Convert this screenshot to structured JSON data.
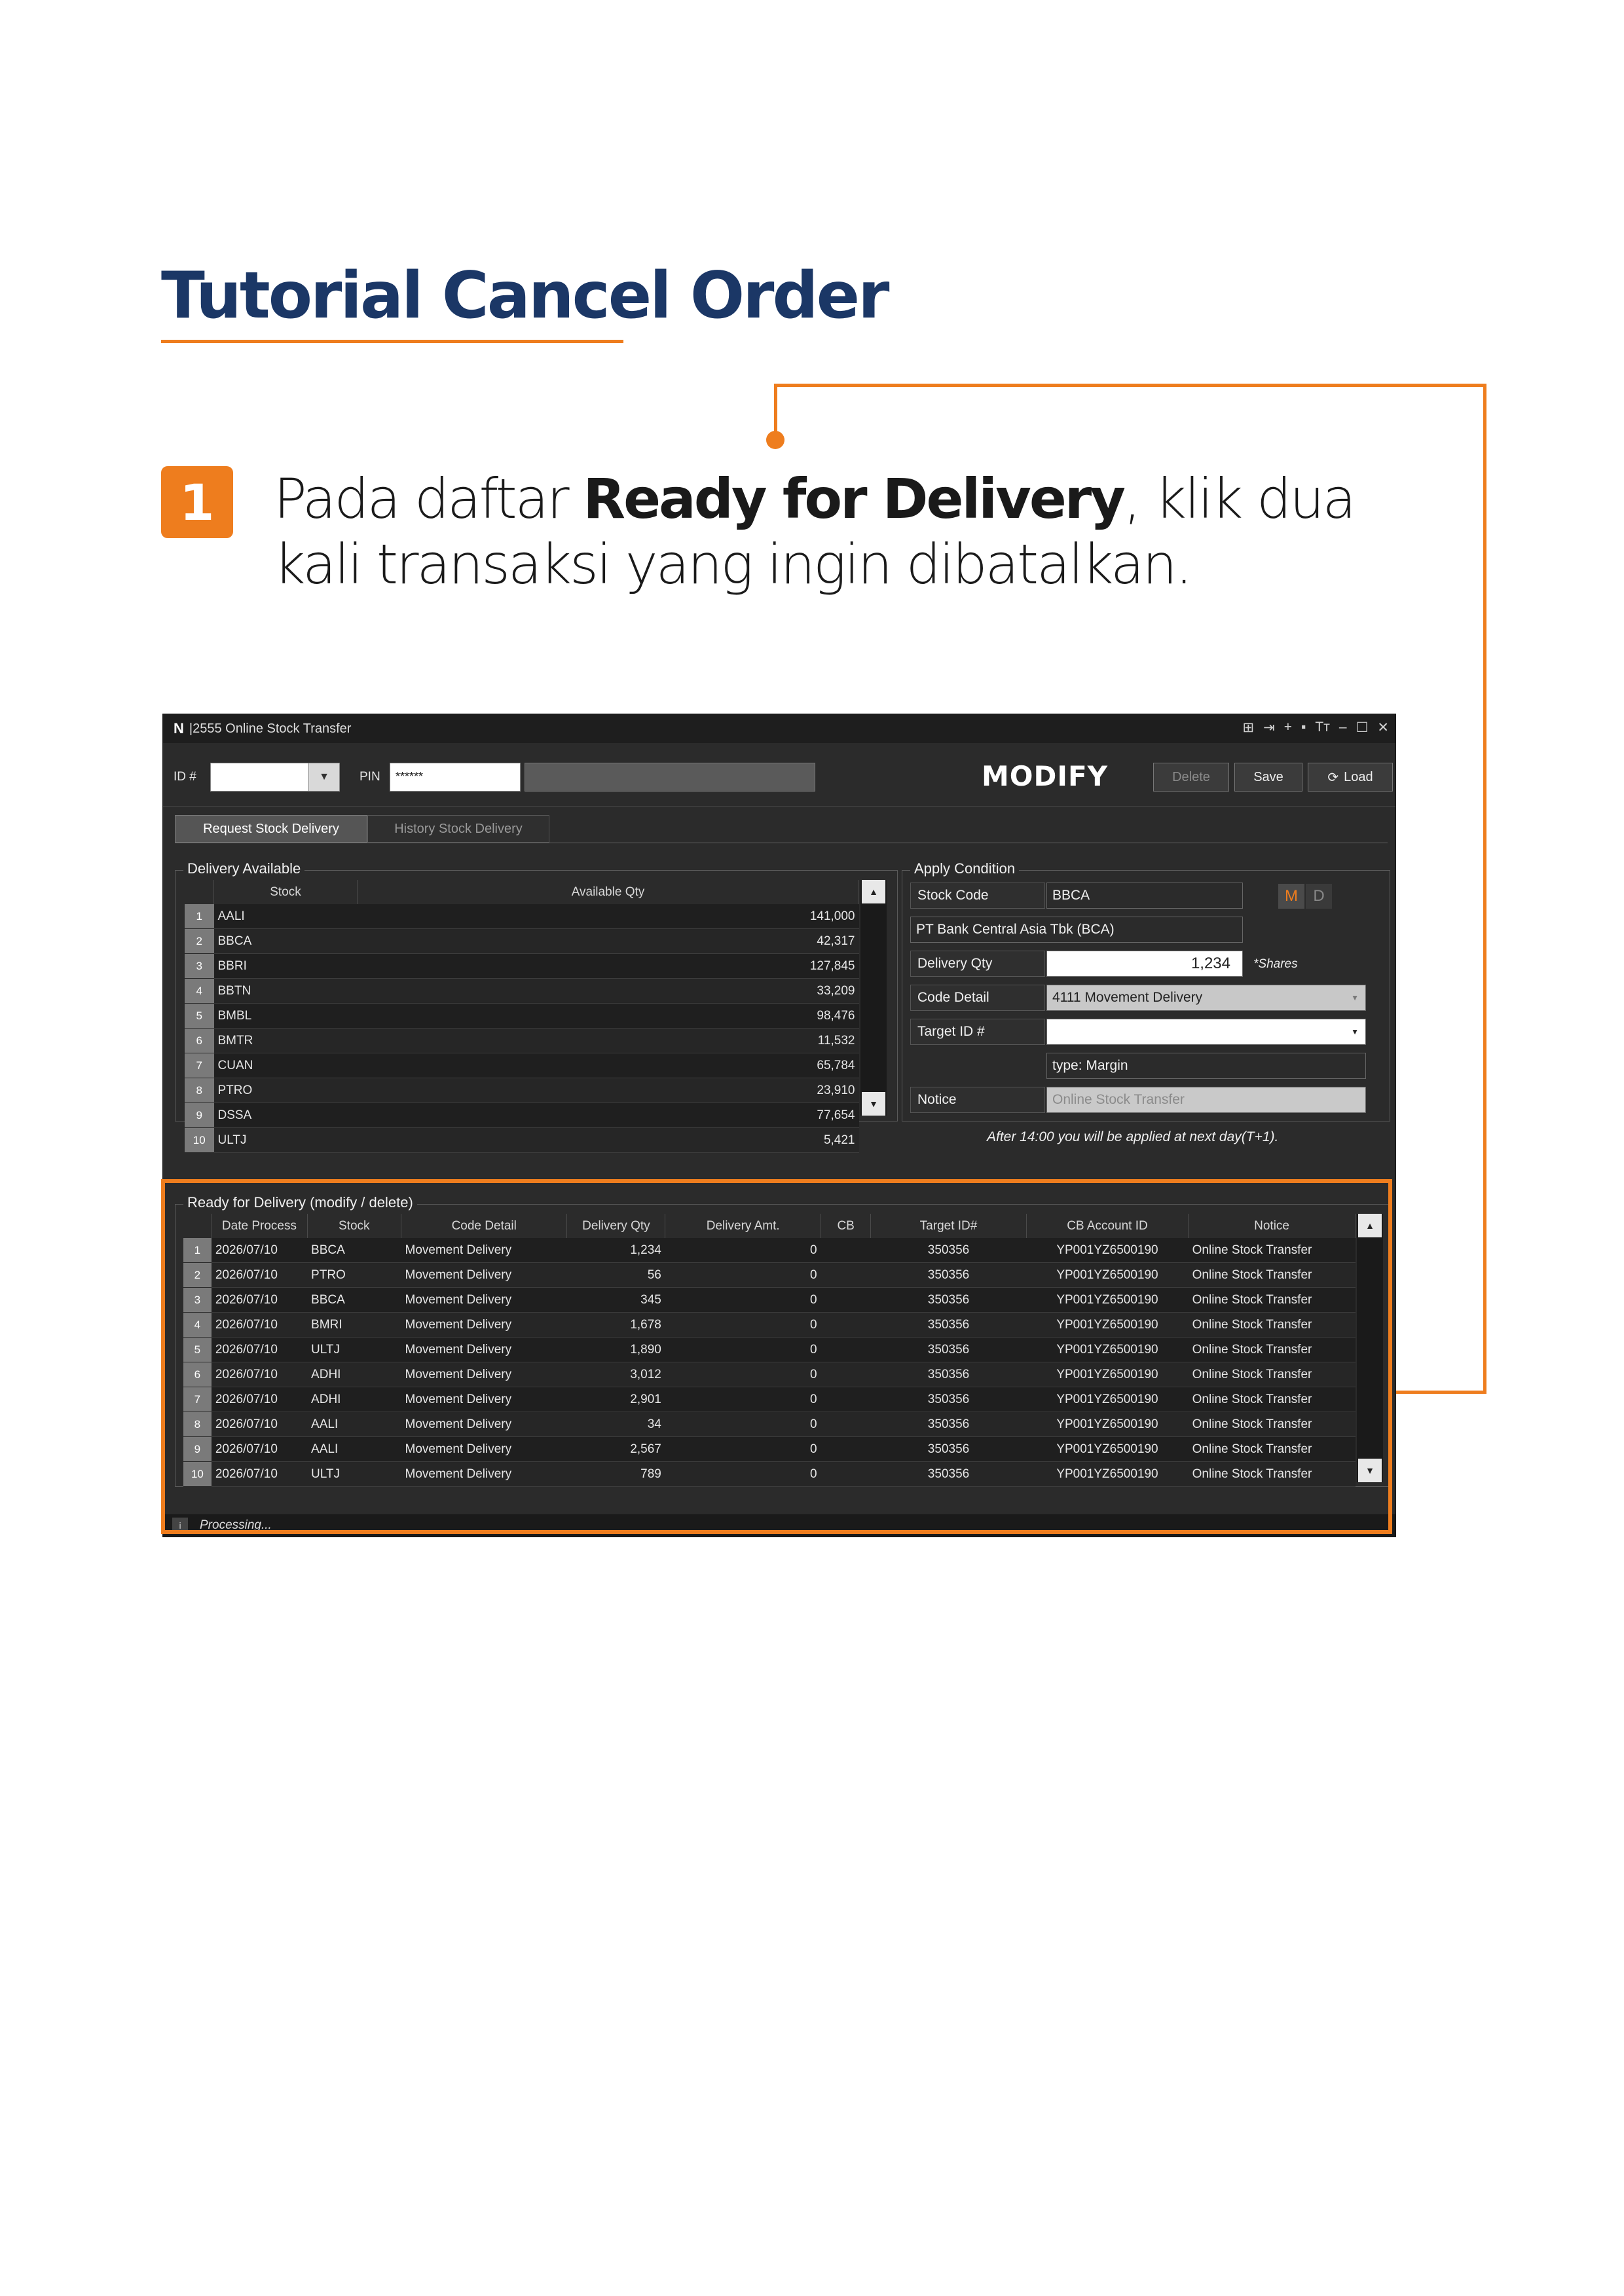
{
  "tutorial": {
    "title": "Tutorial Cancel Order",
    "step_number": "1",
    "step_text_before": "Pada daftar ",
    "step_text_bold": "Ready for Delivery",
    "step_text_after": ", klik dua kali transaksi yang ingin dibatalkan."
  },
  "colors": {
    "accent": "#ee7d1e",
    "title": "#1b3766",
    "window_bg": "#2b2b2b"
  },
  "window": {
    "logo": "N",
    "title": "|2555 Online Stock Transfer",
    "icons": [
      "grid-icon",
      "export-icon",
      "add-icon",
      "trash-icon",
      "font-size-icon",
      "minimize-icon",
      "maximize-icon",
      "close-icon"
    ]
  },
  "toolbar": {
    "id_label": "ID #",
    "id_value": "",
    "pin_label": "PIN",
    "pin_value": "******",
    "mode": "MODIFY",
    "delete_label": "Delete",
    "save_label": "Save",
    "load_label": "Load"
  },
  "tabs": [
    "Request Stock Delivery",
    "History Stock Delivery"
  ],
  "delivery_available": {
    "title": "Delivery Available",
    "columns": [
      "Stock",
      "Available Qty"
    ],
    "rows": [
      [
        "1",
        "AALI",
        "141,000"
      ],
      [
        "2",
        "BBCA",
        "42,317"
      ],
      [
        "3",
        "BBRI",
        "127,845"
      ],
      [
        "4",
        "BBTN",
        "33,209"
      ],
      [
        "5",
        "BMBL",
        "98,476"
      ],
      [
        "6",
        "BMTR",
        "11,532"
      ],
      [
        "7",
        "CUAN",
        "65,784"
      ],
      [
        "8",
        "PTRO",
        "23,910"
      ],
      [
        "9",
        "DSSA",
        "77,654"
      ],
      [
        "10",
        "ULTJ",
        "5,421"
      ]
    ]
  },
  "apply_condition": {
    "title": "Apply Condition",
    "stock_code_label": "Stock Code",
    "stock_code_value": "BBCA",
    "mode_m": "M",
    "mode_d": "D",
    "company_name": "PT Bank Central Asia Tbk (BCA)",
    "delivery_qty_label": "Delivery Qty",
    "delivery_qty_value": "1,234",
    "shares_note": "*Shares",
    "code_detail_label": "Code Detail",
    "code_detail_value": "4111 Movement Delivery",
    "target_id_label": "Target ID #",
    "target_id_value": "",
    "account_type": "type: Margin",
    "notice_label": "Notice",
    "notice_placeholder": "Online Stock Transfer",
    "footnote": "After 14:00 you will be applied at next day(T+1)."
  },
  "ready_for_delivery": {
    "title": "Ready for Delivery (modify / delete)",
    "columns": [
      "Date Process",
      "Stock",
      "Code Detail",
      "Delivery Qty",
      "Delivery Amt.",
      "CB",
      "Target ID#",
      "CB Account ID",
      "Notice"
    ],
    "rows": [
      [
        "1",
        "2026/07/10",
        "BBCA",
        "Movement Delivery",
        "1,234",
        "0",
        "",
        "350356",
        "YP001YZ6500190",
        "Online Stock Transfer"
      ],
      [
        "2",
        "2026/07/10",
        "PTRO",
        "Movement Delivery",
        "56",
        "0",
        "",
        "350356",
        "YP001YZ6500190",
        "Online Stock Transfer"
      ],
      [
        "3",
        "2026/07/10",
        "BBCA",
        "Movement Delivery",
        "345",
        "0",
        "",
        "350356",
        "YP001YZ6500190",
        "Online Stock Transfer"
      ],
      [
        "4",
        "2026/07/10",
        "BMRI",
        "Movement Delivery",
        "1,678",
        "0",
        "",
        "350356",
        "YP001YZ6500190",
        "Online Stock Transfer"
      ],
      [
        "5",
        "2026/07/10",
        "ULTJ",
        "Movement Delivery",
        "1,890",
        "0",
        "",
        "350356",
        "YP001YZ6500190",
        "Online Stock Transfer"
      ],
      [
        "6",
        "2026/07/10",
        "ADHI",
        "Movement Delivery",
        "3,012",
        "0",
        "",
        "350356",
        "YP001YZ6500190",
        "Online Stock Transfer"
      ],
      [
        "7",
        "2026/07/10",
        "ADHI",
        "Movement Delivery",
        "2,901",
        "0",
        "",
        "350356",
        "YP001YZ6500190",
        "Online Stock Transfer"
      ],
      [
        "8",
        "2026/07/10",
        "AALI",
        "Movement Delivery",
        "34",
        "0",
        "",
        "350356",
        "YP001YZ6500190",
        "Online Stock Transfer"
      ],
      [
        "9",
        "2026/07/10",
        "AALI",
        "Movement Delivery",
        "2,567",
        "0",
        "",
        "350356",
        "YP001YZ6500190",
        "Online Stock Transfer"
      ],
      [
        "10",
        "2026/07/10",
        "ULTJ",
        "Movement Delivery",
        "789",
        "0",
        "",
        "350356",
        "YP001YZ6500190",
        "Online Stock Transfer"
      ]
    ]
  },
  "status": {
    "text": "Processing..."
  }
}
